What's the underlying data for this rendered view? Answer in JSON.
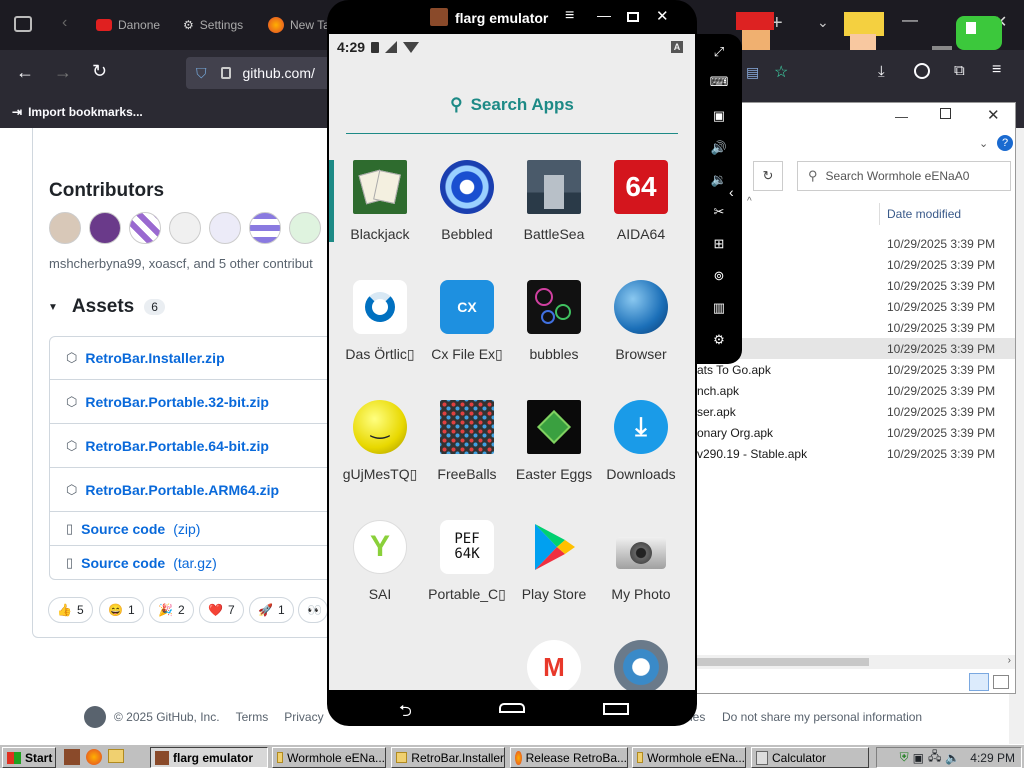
{
  "browser": {
    "tabs": [
      {
        "label": "Danone"
      },
      {
        "label": "Settings"
      },
      {
        "label": "New Ta"
      }
    ],
    "url": "github.com/",
    "bookmarks_label": "Import bookmarks..."
  },
  "github": {
    "contributors_title": "Contributors",
    "contributors_text": "mshcherbyna99, xoascf, and 5 other contribut",
    "assets_title": "Assets",
    "assets_count": "6",
    "assets": [
      {
        "name": "RetroBar.Installer.zip"
      },
      {
        "name": "RetroBar.Portable.32-bit.zip"
      },
      {
        "name": "RetroBar.Portable.64-bit.zip"
      },
      {
        "name": "RetroBar.Portable.ARM64.zip"
      }
    ],
    "sources": [
      {
        "label": "Source code",
        "ext": "(zip)"
      },
      {
        "label": "Source code",
        "ext": "(tar.gz)"
      }
    ],
    "reactions": [
      {
        "emoji": "👍",
        "count": "5"
      },
      {
        "emoji": "😄",
        "count": "1"
      },
      {
        "emoji": "🎉",
        "count": "2"
      },
      {
        "emoji": "❤️",
        "count": "7"
      },
      {
        "emoji": "🚀",
        "count": "1"
      },
      {
        "emoji": "👀",
        "count": ""
      }
    ],
    "footer": {
      "copyright": "© 2025 GitHub, Inc.",
      "links": [
        "Terms",
        "Privacy"
      ],
      "right": [
        "ies",
        "Do not share my personal information"
      ]
    }
  },
  "explorer": {
    "search_placeholder": "Search Wormhole eENaA0",
    "column_date": "Date modified",
    "rows": [
      {
        "name": "",
        "date": "10/29/2025 3:39 PM"
      },
      {
        "name": "",
        "date": "10/29/2025 3:39 PM"
      },
      {
        "name": "",
        "date": "10/29/2025 3:39 PM"
      },
      {
        "name": "",
        "date": "10/29/2025 3:39 PM"
      },
      {
        "name": "",
        "date": "10/29/2025 3:39 PM"
      },
      {
        "name": "k",
        "date": "10/29/2025 3:39 PM"
      },
      {
        "name": "ats To Go.apk",
        "date": "10/29/2025 3:39 PM"
      },
      {
        "name": "nch.apk",
        "date": "10/29/2025 3:39 PM"
      },
      {
        "name": "ser.apk",
        "date": "10/29/2025 3:39 PM"
      },
      {
        "name": "onary Org.apk",
        "date": "10/29/2025 3:39 PM"
      },
      {
        "name": "v290.19 - Stable.apk",
        "date": "10/29/2025 3:39 PM"
      }
    ]
  },
  "emulator": {
    "title": "flarg emulator",
    "time": "4:29",
    "search_label": "Search Apps",
    "apps": [
      {
        "label": "Blackjack",
        "icon": "cards-icon",
        "color": "#2e6b2e"
      },
      {
        "label": "Bebbled",
        "icon": "blue-orb-icon",
        "color": "#1a4fd0"
      },
      {
        "label": "BattleSea",
        "icon": "battleship-icon",
        "color": "#3c4a5a"
      },
      {
        "label": "AIDA64",
        "icon": "aida64-icon",
        "color": "#d4151d"
      },
      {
        "label": "Das Örtlic▯",
        "icon": "das-oertliche-icon",
        "color": "#0070c0"
      },
      {
        "label": "Cx File Ex▯",
        "icon": "cx-folder-icon",
        "color": "#1e90e0"
      },
      {
        "label": "bubbles",
        "icon": "bubbles-icon",
        "color": "#111111"
      },
      {
        "label": "Browser",
        "icon": "globe-icon",
        "color": "#1b6fb8"
      },
      {
        "label": "gUjMesTQ▯",
        "icon": "smiley-icon",
        "color": "#f0e010"
      },
      {
        "label": "FreeBalls",
        "icon": "balls-grid-icon",
        "color": "#333333"
      },
      {
        "label": "Easter Eggs",
        "icon": "easter-egg-icon",
        "color": "#0a0a0a"
      },
      {
        "label": "Downloads",
        "icon": "download-icon",
        "color": "#1a9be8"
      },
      {
        "label": "SAI",
        "icon": "sai-icon",
        "color": "#ffffff"
      },
      {
        "label": "Portable_C▯",
        "icon": "perf64k-icon",
        "color": "#ffffff"
      },
      {
        "label": "Play Store",
        "icon": "play-store-icon",
        "color": "#ffffff"
      },
      {
        "label": "My Photo",
        "icon": "camera-icon",
        "color": "#dddddd"
      }
    ]
  },
  "taskbar": {
    "start": "Start",
    "items": [
      {
        "label": "flarg emulator"
      },
      {
        "label": "Wormhole eENa..."
      },
      {
        "label": "RetroBar.Installer"
      },
      {
        "label": "Release RetroBa..."
      },
      {
        "label": "Wormhole eENa..."
      },
      {
        "label": "Calculator"
      }
    ],
    "clock": "4:29 PM"
  }
}
